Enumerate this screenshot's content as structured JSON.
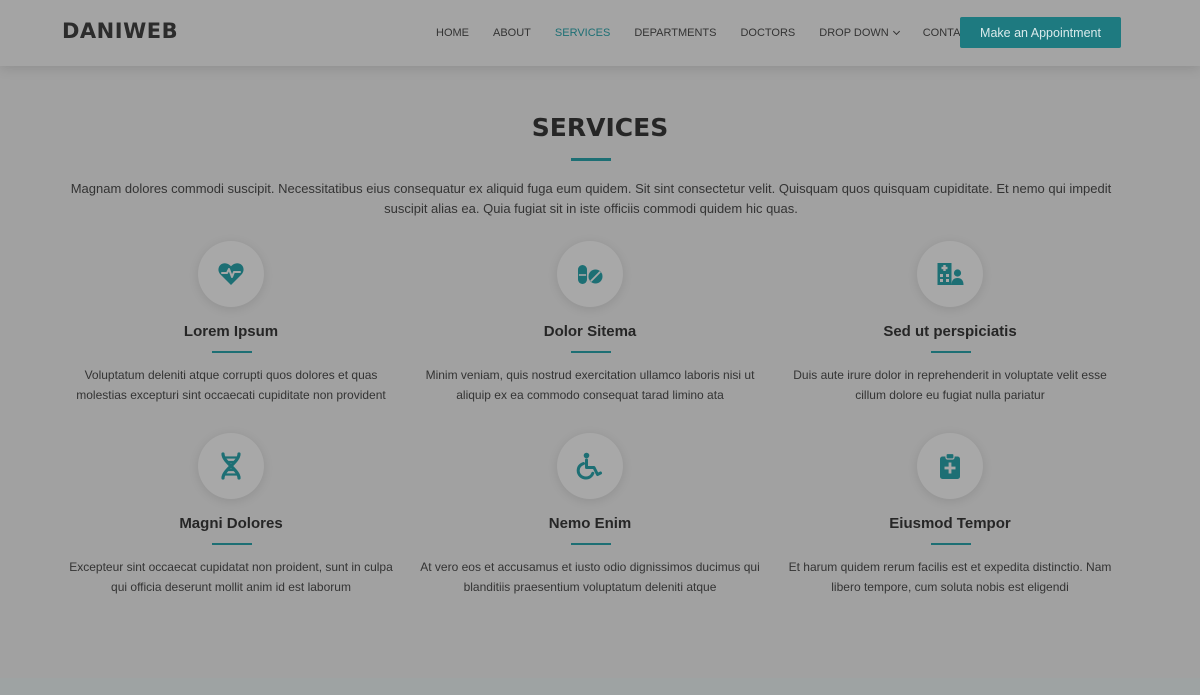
{
  "header": {
    "logo": "DANIWEB",
    "nav": [
      {
        "label": "HOME"
      },
      {
        "label": "ABOUT"
      },
      {
        "label": "SERVICES"
      },
      {
        "label": "DEPARTMENTS"
      },
      {
        "label": "DOCTORS"
      },
      {
        "label": "DROP DOWN"
      },
      {
        "label": "CONTACT"
      }
    ],
    "active_nav": "SERVICES",
    "cta_label": "Make an Appointment"
  },
  "section": {
    "title": "SERVICES",
    "description": "Magnam dolores commodi suscipit. Necessitatibus eius consequatur ex aliquid fuga eum quidem. Sit sint consectetur velit. Quisquam quos quisquam cupiditate. Et nemo qui impedit suscipit alias ea. Quia fugiat sit in iste officiis commodi quidem hic quas."
  },
  "services": [
    {
      "icon": "heart-pulse-icon",
      "title": "Lorem Ipsum",
      "text": "Voluptatum deleniti atque corrupti quos dolores et quas molestias excepturi sint occaecati cupiditate non provident"
    },
    {
      "icon": "pills-icon",
      "title": "Dolor Sitema",
      "text": "Minim veniam, quis nostrud exercitation ullamco laboris nisi ut aliquip ex ea commodo consequat tarad limino ata"
    },
    {
      "icon": "hospital-user-icon",
      "title": "Sed ut perspiciatis",
      "text": "Duis aute irure dolor in reprehenderit in voluptate velit esse cillum dolore eu fugiat nulla pariatur"
    },
    {
      "icon": "dna-icon",
      "title": "Magni Dolores",
      "text": "Excepteur sint occaecat cupidatat non proident, sunt in culpa qui officia deserunt mollit anim id est laborum"
    },
    {
      "icon": "wheelchair-icon",
      "title": "Nemo Enim",
      "text": "At vero eos et accusamus et iusto odio dignissimos ducimus qui blanditiis praesentium voluptatum deleniti atque"
    },
    {
      "icon": "notes-medical-icon",
      "title": "Eiusmod Tempor",
      "text": "Et harum quidem rerum facilis est et expedita distinctio. Nam libero tempore, cum soluta nobis est eligendi"
    }
  ],
  "colors": {
    "accent": "#1d6f74",
    "background": "#a1a1a1",
    "text": "#333333"
  }
}
